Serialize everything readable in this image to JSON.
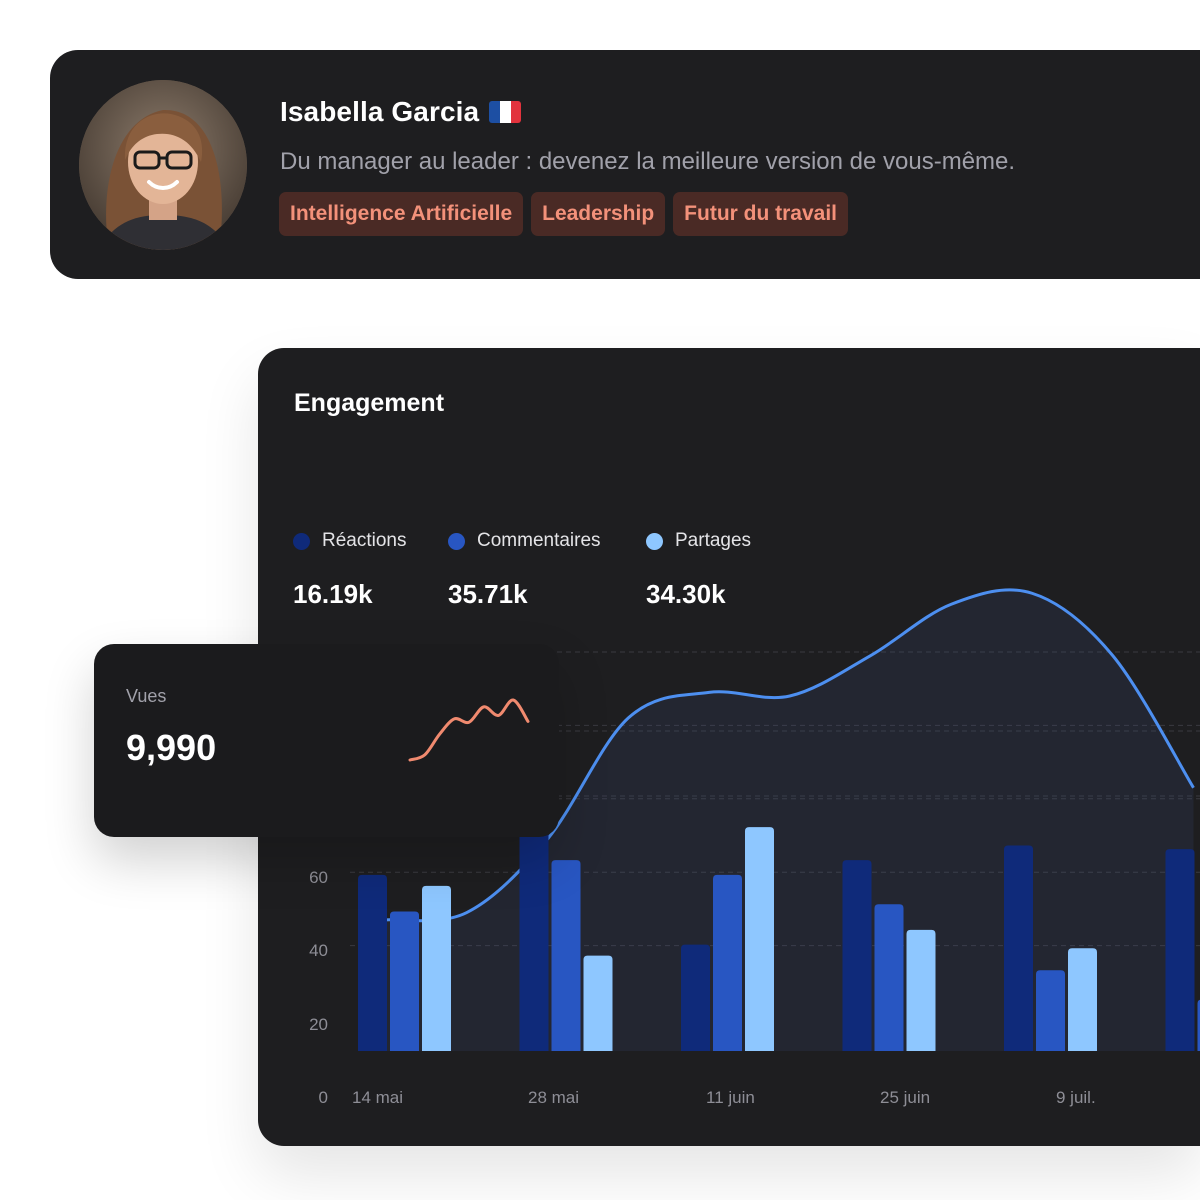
{
  "profile": {
    "name": "Isabella Garcia",
    "flag_icon": "france-flag-icon",
    "flag_colors": [
      "#1d4fa3",
      "#ffffff",
      "#e2333d"
    ],
    "bio": "Du manager au leader : devenez la meilleure version de vous-même.",
    "tags": [
      "Intelligence Artificielle",
      "Leadership",
      "Futur du travail"
    ]
  },
  "colors": {
    "tag_bg": "#4a2a25",
    "tag_text": "#f3917a",
    "reactions": "#0f2a7a",
    "commentaires": "#2856c2",
    "partages": "#8ec7ff",
    "line": "#4d8ff0",
    "sparkline": "#f08a6f"
  },
  "engagement": {
    "title": "Engagement",
    "legend": [
      {
        "label": "Réactions",
        "value": "16.19k",
        "color": "#0f2a7a"
      },
      {
        "label": "Commentaires",
        "value": "35.71k",
        "color": "#2856c2"
      },
      {
        "label": "Partages",
        "value": "34.30k",
        "color": "#8ec7ff"
      }
    ]
  },
  "vues": {
    "label": "Vues",
    "value": "9,990",
    "sparkline": [
      0,
      6,
      30,
      48,
      44,
      62,
      52,
      70,
      45
    ]
  },
  "chart_data": {
    "type": "bar",
    "categories": [
      "14 mai",
      "28 mai",
      "11 juin",
      "25 juin",
      "9 juil."
    ],
    "y_ticks": [
      "0",
      "20",
      "40",
      "60"
    ],
    "ylim": [
      0,
      140
    ],
    "series": [
      {
        "name": "Réactions",
        "values": [
          48,
          63,
          29,
          52,
          56,
          55
        ]
      },
      {
        "name": "Commentaires",
        "values": [
          38,
          52,
          48,
          40,
          22,
          14
        ]
      },
      {
        "name": "Partages",
        "values": [
          45,
          26,
          61,
          33,
          28,
          null
        ]
      }
    ],
    "line_series": {
      "x": [
        0,
        0.5,
        1,
        1.5,
        2,
        2.5,
        3,
        3.5,
        4,
        4.5,
        5
      ],
      "values": [
        36,
        38,
        58,
        91,
        98,
        97,
        108,
        122,
        125,
        108,
        72
      ]
    },
    "grid": true
  }
}
